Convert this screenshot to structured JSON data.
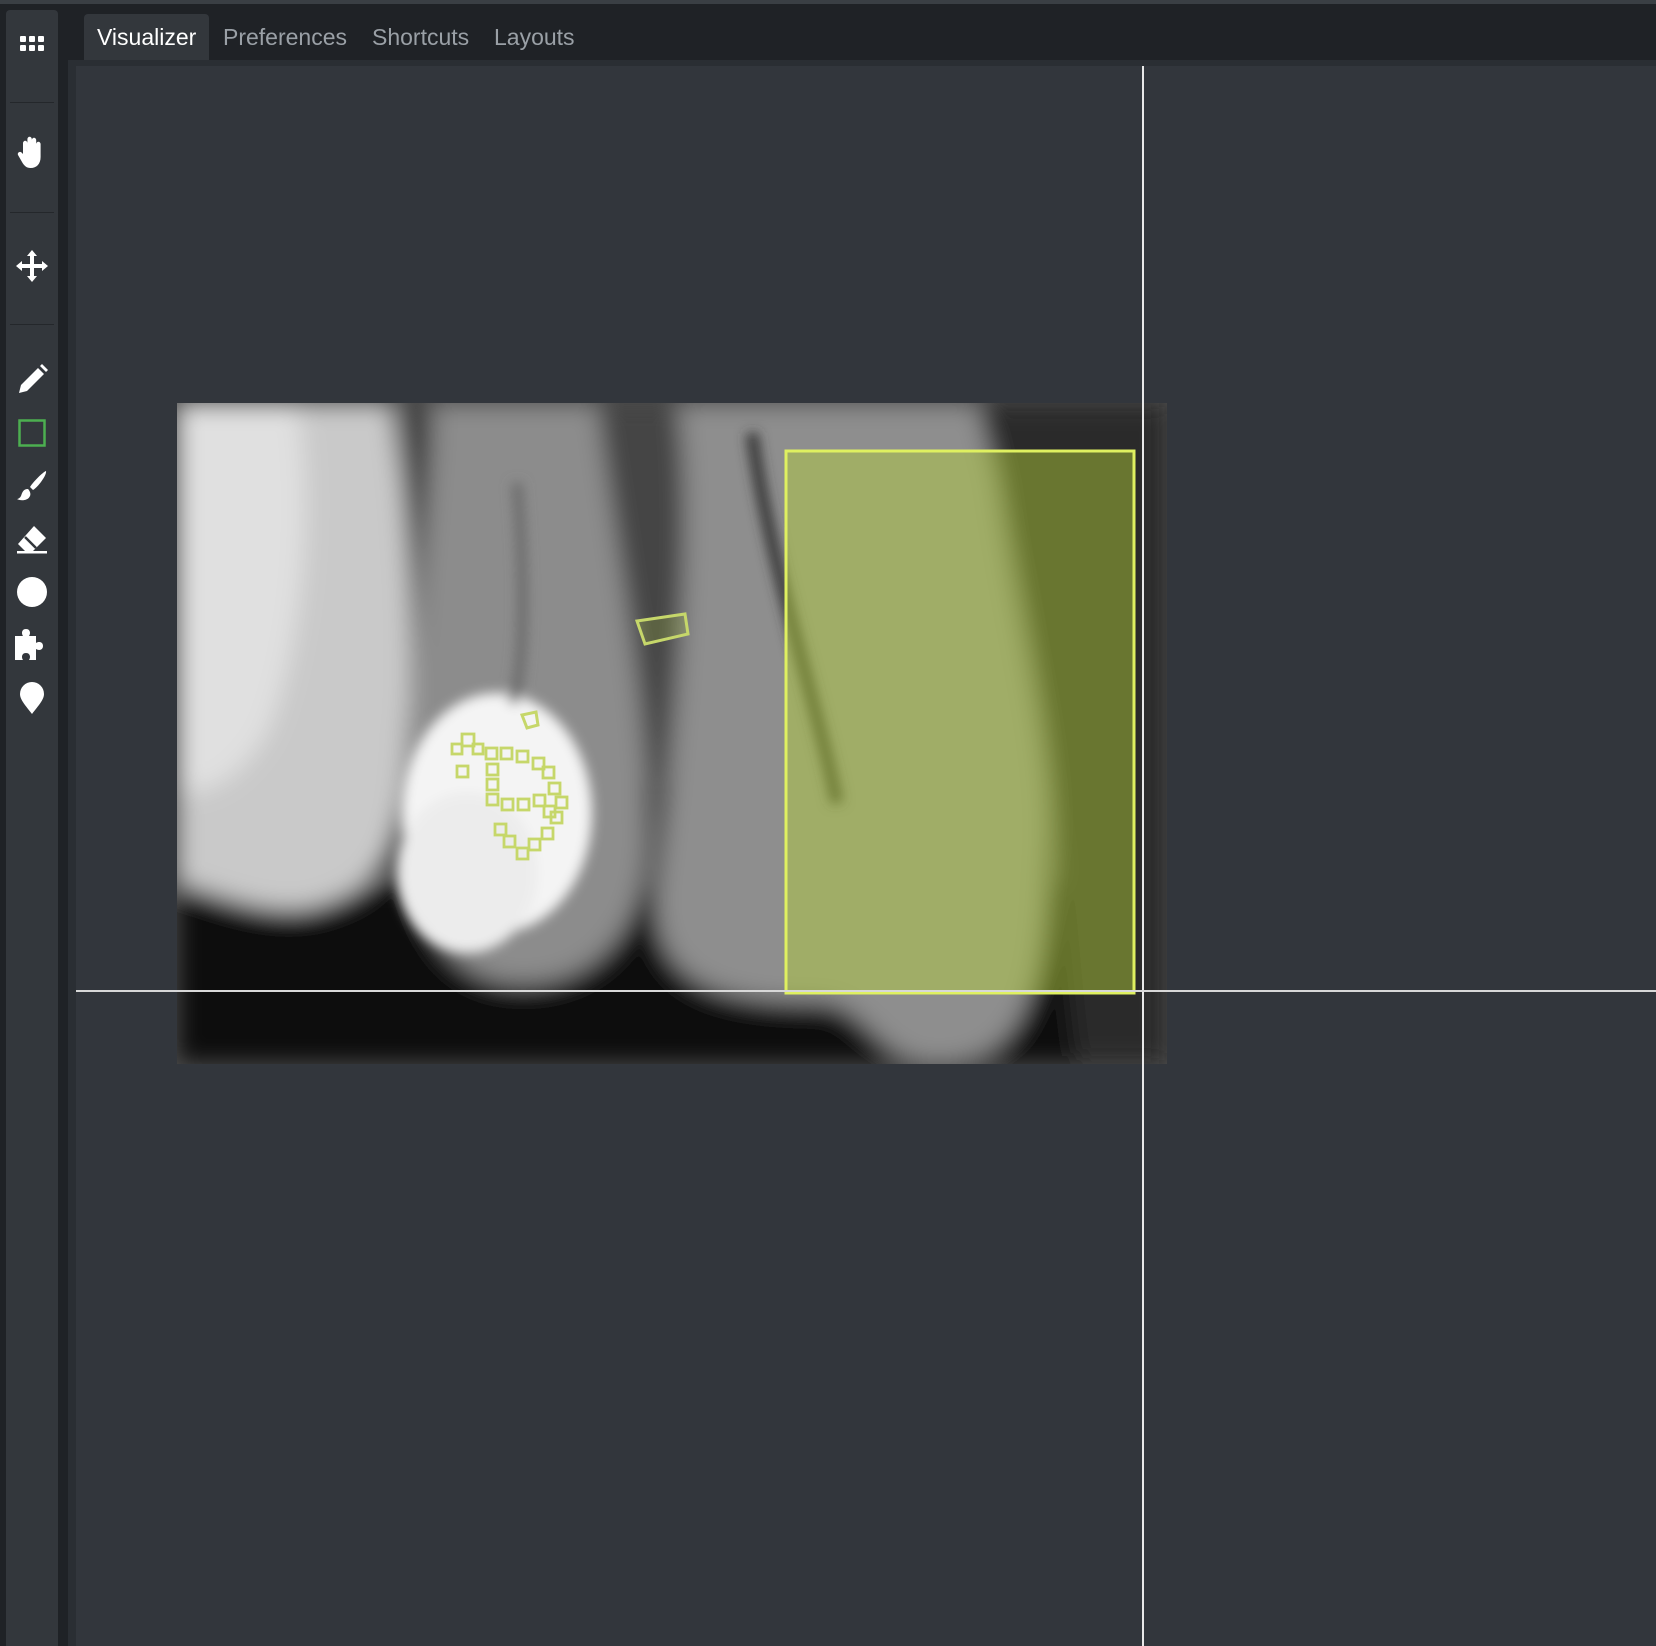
{
  "tabs": {
    "visualizer": "Visualizer",
    "preferences": "Preferences",
    "shortcuts": "Shortcuts",
    "layouts": "Layouts"
  },
  "toolbar": {
    "tools": [
      "grid-icon",
      "hand-icon",
      "move-icon",
      "pencil-icon",
      "rectangle-icon",
      "brush-icon",
      "eraser-icon",
      "circle-icon",
      "puzzle-icon",
      "pin-icon"
    ],
    "active_tool": "rectangle-icon"
  },
  "colors": {
    "background": "#32363c",
    "toolbar": "#33373c",
    "annotation": "#d4ea5a",
    "active_tool": "#4caf50"
  }
}
